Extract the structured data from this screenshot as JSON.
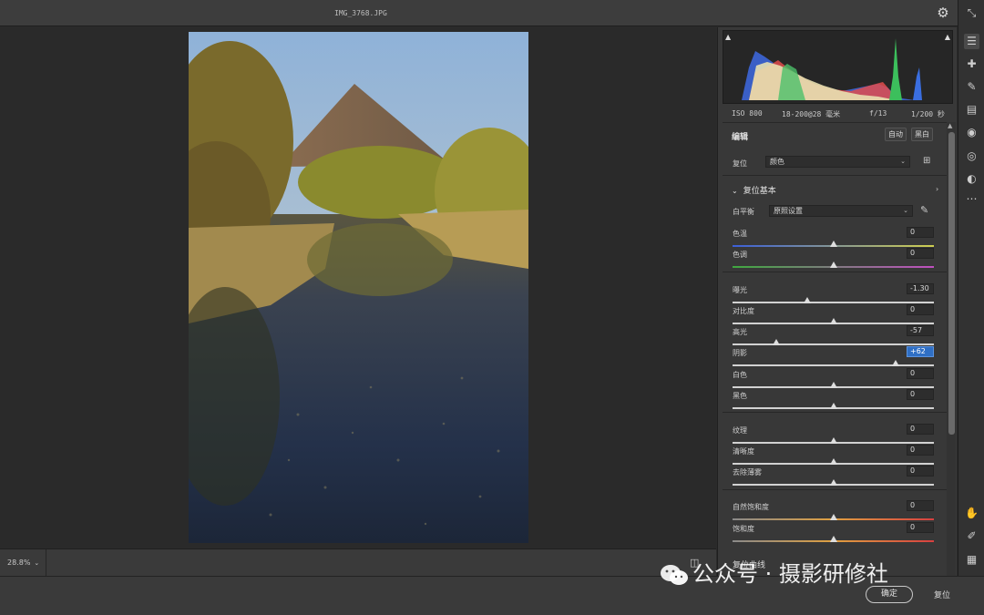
{
  "window": {
    "file_name": "IMG_3768.JPG"
  },
  "canvas": {
    "zoom": "28.8%"
  },
  "histogram": {
    "camera": {
      "iso": "ISO 800",
      "lens": "18-200@28 毫米",
      "aperture": "f/13",
      "shutter": "1/200 秒"
    }
  },
  "edit": {
    "title": "编辑",
    "auto_label": "自动",
    "bw_label": "黑白",
    "profile_label": "复位",
    "profile_value": "颜色"
  },
  "basic": {
    "title": "复位基本",
    "wb_label": "白平衡",
    "wb_value": "原照设置",
    "sliders": [
      {
        "label": "色温",
        "value": "0",
        "pos": 0.5,
        "track": "temp"
      },
      {
        "label": "色调",
        "value": "0",
        "pos": 0.5,
        "track": "tint"
      },
      {
        "label": "曝光",
        "value": "-1.30",
        "pos": 0.37,
        "track": "plain"
      },
      {
        "label": "对比度",
        "value": "0",
        "pos": 0.5,
        "track": "plain"
      },
      {
        "label": "高光",
        "value": "-57",
        "pos": 0.215,
        "track": "plain"
      },
      {
        "label": "阴影",
        "value": "+62",
        "pos": 0.81,
        "track": "plain",
        "active": true
      },
      {
        "label": "白色",
        "value": "0",
        "pos": 0.5,
        "track": "plain"
      },
      {
        "label": "黑色",
        "value": "0",
        "pos": 0.5,
        "track": "plain"
      },
      {
        "label": "纹理",
        "value": "0",
        "pos": 0.5,
        "track": "plain"
      },
      {
        "label": "清晰度",
        "value": "0",
        "pos": 0.5,
        "track": "plain"
      },
      {
        "label": "去除薄雾",
        "value": "0",
        "pos": 0.5,
        "track": "plain"
      },
      {
        "label": "自然饱和度",
        "value": "0",
        "pos": 0.5,
        "track": "vibrance"
      },
      {
        "label": "饱和度",
        "value": "0",
        "pos": 0.5,
        "track": "saturation"
      }
    ]
  },
  "curve_section": {
    "title": "复位曲线"
  },
  "footer": {
    "ok_label": "确定",
    "reset_label": "复位"
  },
  "watermark": {
    "text": "公众号 · 摄影研修社"
  },
  "colors": {
    "accent": "#2f6fc5",
    "panel": "#383838",
    "canvas": "#2a2a2a"
  }
}
